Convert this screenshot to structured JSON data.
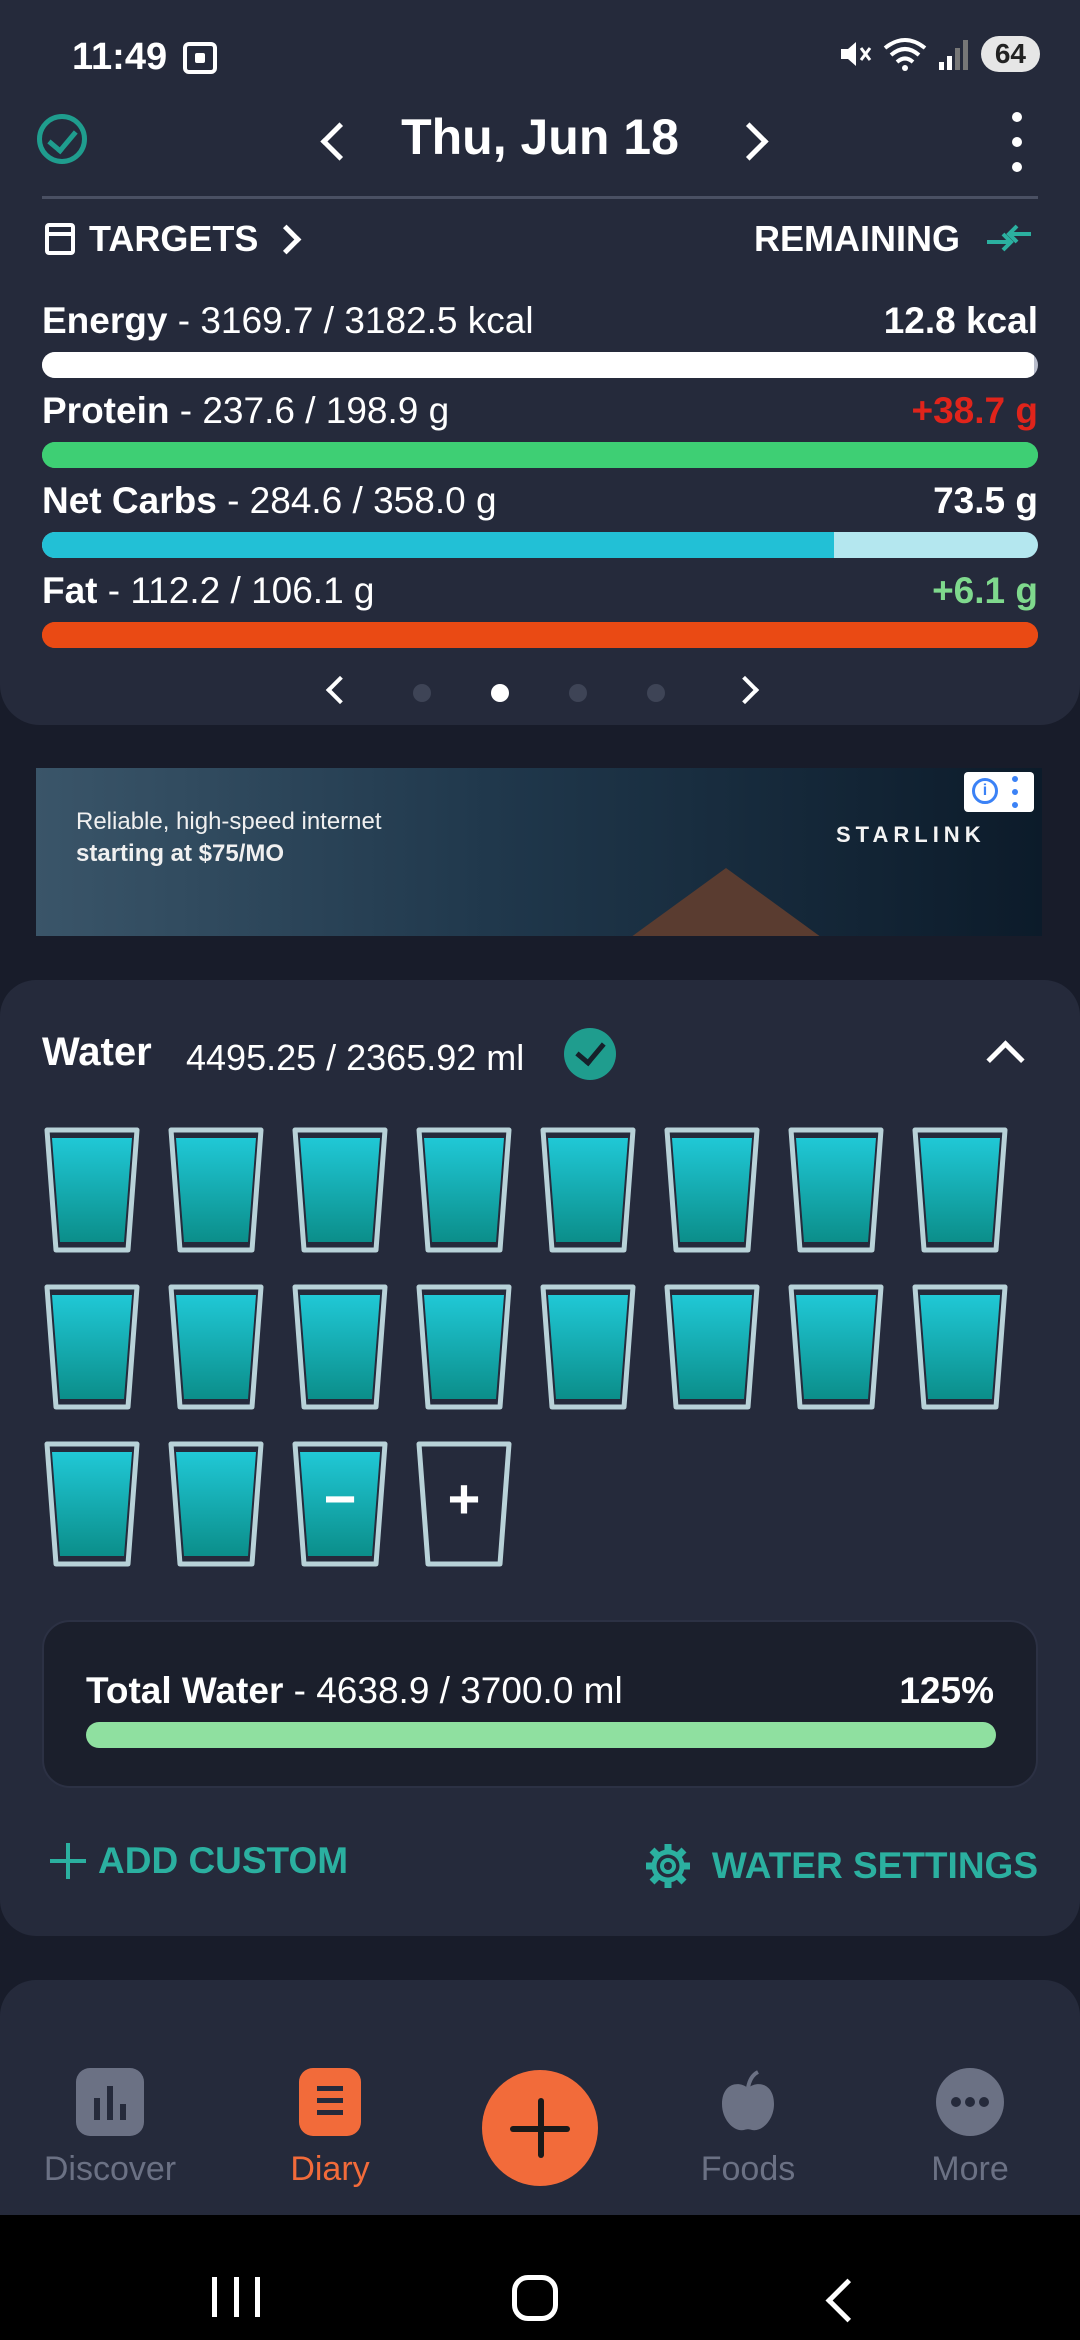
{
  "status": {
    "time": "11:49",
    "battery": "64"
  },
  "header": {
    "date": "Thu, Jun 18",
    "targets_label": "TARGETS",
    "remaining_label": "REMAINING"
  },
  "nutrients": [
    {
      "name": "Energy",
      "detail": "- 3169.7 / 3182.5 kcal",
      "remaining": "12.8 kcal",
      "remaining_color": "#ffffff",
      "bar_color": "#ffffff",
      "track_color": "#b8bccb",
      "fill_fraction": 0.996
    },
    {
      "name": "Protein",
      "detail": "- 237.6 / 198.9 g",
      "remaining": "+38.7 g",
      "remaining_color": "#e0241b",
      "bar_color": "#3ecf74",
      "track_color": "#3ecf74",
      "fill_fraction": 1.0
    },
    {
      "name": "Net Carbs",
      "detail": "- 284.6 / 358.0 g",
      "remaining": "73.5 g",
      "remaining_color": "#ffffff",
      "bar_color": "#22c0d6",
      "track_color": "#b4e7ef",
      "fill_fraction": 0.795
    },
    {
      "name": "Fat",
      "detail": "- 112.2 / 106.1 g",
      "remaining": "+6.1 g",
      "remaining_color": "#7fd98d",
      "bar_color": "#ea4a14",
      "track_color": "#ea4a14",
      "fill_fraction": 1.0
    }
  ],
  "pager": {
    "count": 4,
    "active_index": 1
  },
  "ad": {
    "line1": "Reliable, high-speed internet",
    "line2": "starting at $75/MO",
    "brand": "STARLINK",
    "info_icon": "info-icon"
  },
  "water": {
    "title": "Water",
    "amount": "4495.25 / 2365.92 ml",
    "full_glasses": 18,
    "minus_symbol": "−",
    "plus_symbol": "+",
    "total_label": "Total Water",
    "total_detail": "- 4638.9 / 3700.0 ml",
    "total_percent": "125%",
    "add_custom": "ADD CUSTOM",
    "settings": "WATER SETTINGS"
  },
  "nav": {
    "items": [
      {
        "label": "Discover",
        "icon": "chart-icon"
      },
      {
        "label": "Diary",
        "icon": "diary-icon"
      },
      {
        "label": "Foods",
        "icon": "apple-icon"
      },
      {
        "label": "More",
        "icon": "more-icon"
      }
    ]
  },
  "colors": {
    "accent": "#f26b3a",
    "teal": "#2bb0a0",
    "card": "#252a3b",
    "background": "#181c2a"
  }
}
